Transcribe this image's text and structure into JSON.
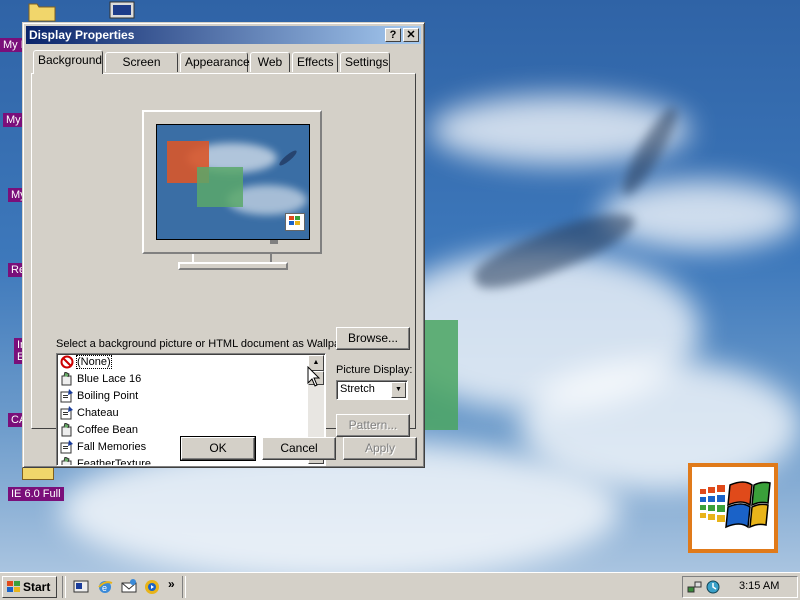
{
  "desktop": {
    "icons": [
      {
        "label": "My D"
      },
      {
        "label": "My"
      },
      {
        "label": "My"
      },
      {
        "label": "Re"
      },
      {
        "label": "In\nE"
      },
      {
        "label": "CA"
      },
      {
        "label": "IE 6.0 Full"
      }
    ]
  },
  "dialog": {
    "title": "Display Properties",
    "help_btn": "?",
    "close_btn": "✕",
    "tabs": [
      {
        "label": "Background",
        "active": true
      },
      {
        "label": "Screen Saver"
      },
      {
        "label": "Appearance"
      },
      {
        "label": "Web"
      },
      {
        "label": "Effects"
      },
      {
        "label": "Settings"
      }
    ],
    "wallpaper_prompt": "Select a background picture or HTML document as Wallpaper:",
    "wallpaper_list": [
      {
        "label": "(None)",
        "icon": "none-icon"
      },
      {
        "label": "Blue Lace 16",
        "icon": "bitmap-icon"
      },
      {
        "label": "Boiling Point",
        "icon": "html-icon"
      },
      {
        "label": "Chateau",
        "icon": "html-icon"
      },
      {
        "label": "Coffee Bean",
        "icon": "bitmap-icon"
      },
      {
        "label": "Fall Memories",
        "icon": "html-icon"
      },
      {
        "label": "FeatherTexture",
        "icon": "bitmap-icon"
      }
    ],
    "browse": "Browse...",
    "picture_display_label": "Picture Display:",
    "picture_display_value": "Stretch",
    "pattern": "Pattern...",
    "ok": "OK",
    "cancel": "Cancel",
    "apply": "Apply"
  },
  "taskbar": {
    "start": "Start",
    "overflow": "»",
    "clock": "3:15 AM"
  }
}
